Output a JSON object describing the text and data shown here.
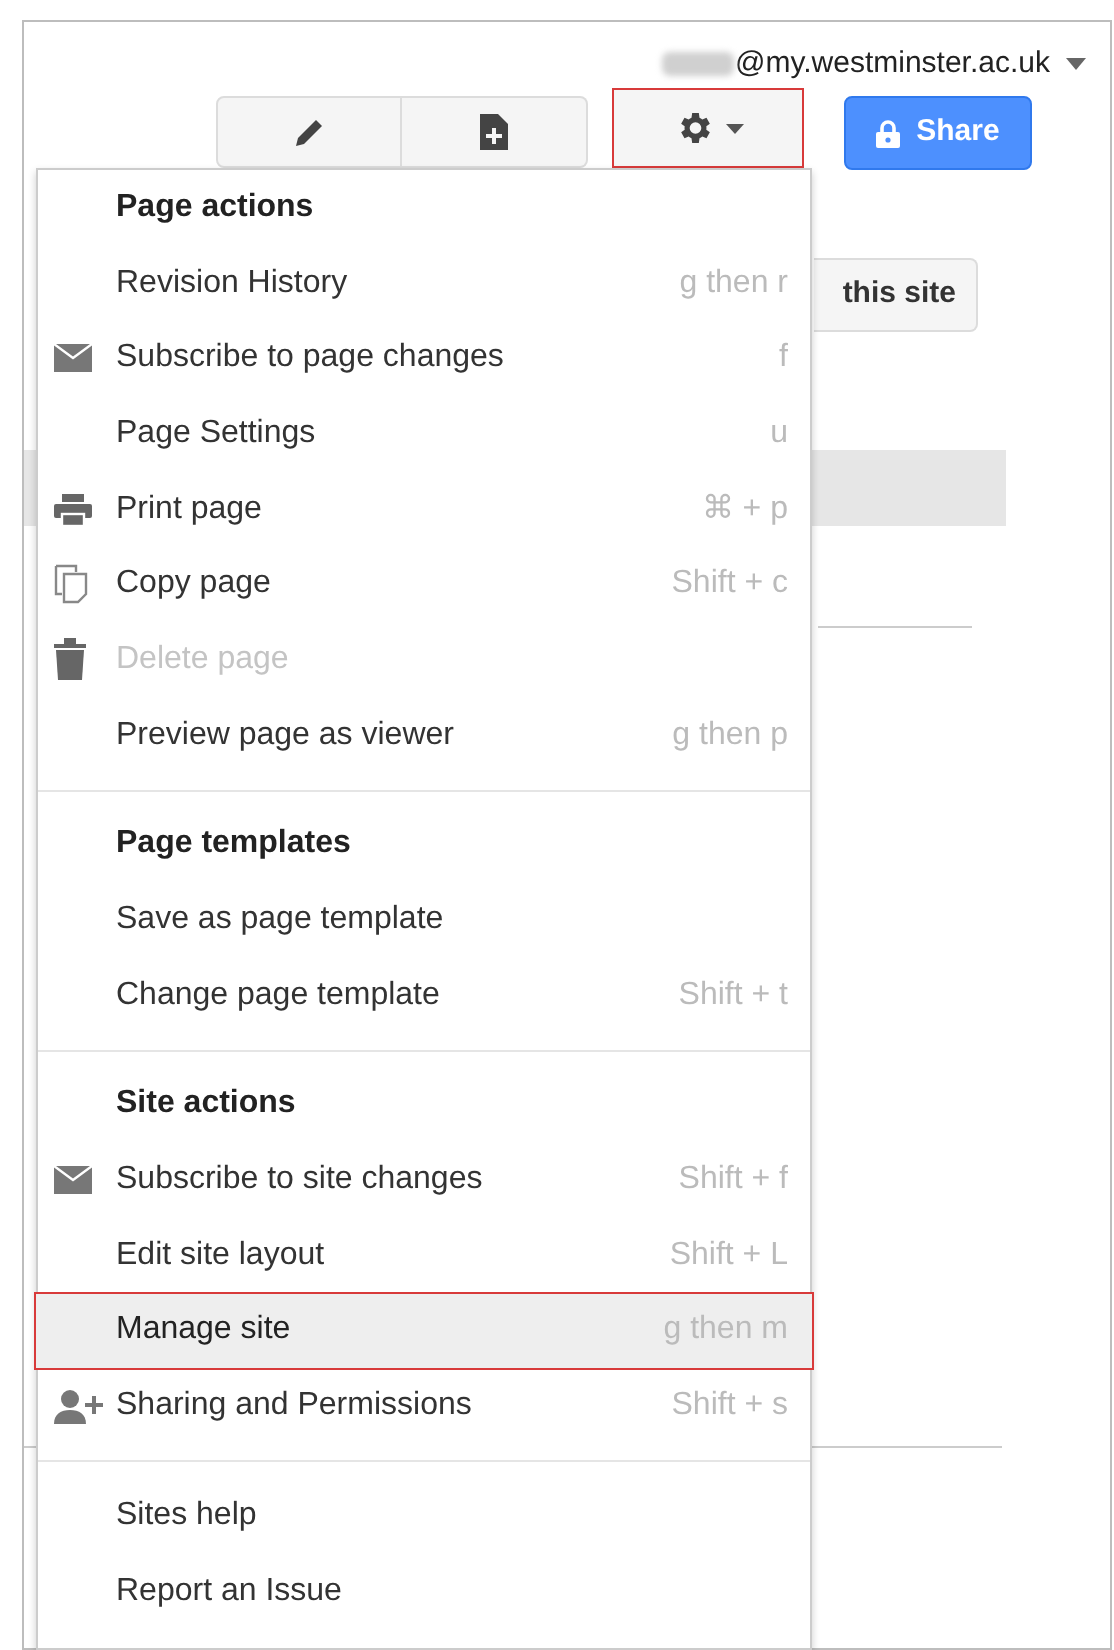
{
  "account": {
    "email": "@my.westminster.ac.uk",
    "name_redacted": true
  },
  "toolbar": {
    "buttons": [
      {
        "kind": "pencil"
      },
      {
        "kind": "page-add"
      }
    ]
  },
  "settings_button": {
    "annotated": true
  },
  "share_button": {
    "label": "Share"
  },
  "background": {
    "button_label": "this site"
  },
  "menu": {
    "sections": [
      {
        "title": "Page actions",
        "items": [
          {
            "label": "Revision History",
            "shortcut": "g then r",
            "disabled": false,
            "selected": false
          },
          {
            "label": "Subscribe to page changes",
            "shortcut": "f",
            "kind": "mail",
            "disabled": false,
            "selected": false
          },
          {
            "label": "Page Settings",
            "shortcut": "u",
            "disabled": false,
            "selected": false
          },
          {
            "label": "Print page",
            "shortcut": "⌘ + p",
            "kind": "print",
            "disabled": false,
            "selected": false
          },
          {
            "label": "Copy page",
            "shortcut": "Shift + c",
            "kind": "copy",
            "disabled": false,
            "selected": false
          },
          {
            "label": "Delete page",
            "kind": "trash",
            "disabled": true,
            "selected": false
          },
          {
            "label": "Preview page as viewer",
            "shortcut": "g then p",
            "disabled": false,
            "selected": false
          }
        ]
      },
      {
        "title": "Page templates",
        "items": [
          {
            "label": "Save as page template",
            "disabled": false,
            "selected": false
          },
          {
            "label": "Change page template",
            "shortcut": "Shift + t",
            "disabled": false,
            "selected": false
          }
        ]
      },
      {
        "title": "Site actions",
        "items": [
          {
            "label": "Subscribe to site changes",
            "shortcut": "Shift + f",
            "kind": "mail",
            "disabled": false,
            "selected": false
          },
          {
            "label": "Edit site layout",
            "shortcut": "Shift + L",
            "disabled": false,
            "selected": false
          },
          {
            "label": "Manage site",
            "shortcut": "g then m",
            "disabled": false,
            "selected": true
          },
          {
            "label": "Sharing and Permissions",
            "shortcut": "Shift + s",
            "kind": "person-add",
            "disabled": false,
            "selected": false
          }
        ]
      },
      {
        "items": [
          {
            "label": "Sites help",
            "disabled": false,
            "selected": false
          },
          {
            "label": "Report an Issue",
            "disabled": false,
            "selected": false
          }
        ]
      }
    ]
  }
}
